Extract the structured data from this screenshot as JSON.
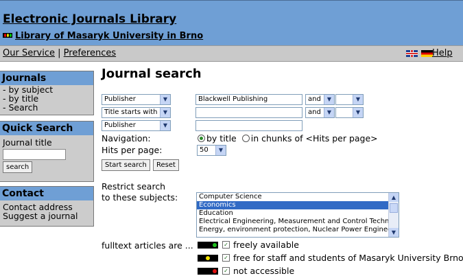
{
  "header": {
    "title": "Electronic Journals Library",
    "library": "Library of Masaryk University in Brno"
  },
  "servicebar": {
    "our_service": "Our Service",
    "separator": "|",
    "preferences": "Preferences",
    "flags": [
      "uk-flag-icon",
      "de-flag-icon"
    ],
    "help": "Help"
  },
  "sidebar": {
    "journals": {
      "title": "Journals",
      "items": [
        "- by subject",
        "- by title",
        "- Search"
      ]
    },
    "quick_search": {
      "title": "Quick Search",
      "label": "Journal title",
      "value": "",
      "button": "search"
    },
    "contact": {
      "title": "Contact",
      "items": [
        "Contact address",
        "Suggest a journal"
      ]
    }
  },
  "main": {
    "title": "Journal search",
    "rows": [
      {
        "field": "Publisher",
        "value": "Blackwell Publishing",
        "op": "and",
        "extra": ""
      },
      {
        "field": "Title starts with ...",
        "value": "",
        "op": "and",
        "extra": ""
      },
      {
        "field": "Publisher",
        "value": ""
      }
    ],
    "navigation_label": "Navigation:",
    "navigation_options": [
      "by title",
      "in chunks of <Hits per page>"
    ],
    "navigation_selected": "by title",
    "hits_label": "Hits per page:",
    "hits_value": "50",
    "start_button": "Start search",
    "reset_button": "Reset",
    "restrict_label_1": "Restrict search",
    "restrict_label_2": "to these subjects:",
    "subjects": [
      "Computer Science",
      "Economics",
      "Education",
      "Electrical Engineering, Measurement and Control Technology",
      "Energy, environment protection, Nuclear Power Engineering"
    ],
    "selected_subject": "Economics",
    "fulltext_label": "fulltext articles are ...",
    "access": [
      {
        "label": "freely available",
        "light": "green",
        "checked": true
      },
      {
        "label": "free for staff and students of Masaryk University Brno",
        "light": "yellow",
        "checked": true
      },
      {
        "label": "not accessible",
        "light": "red",
        "checked": true
      }
    ]
  },
  "colors": {
    "header_bg": "#6f9fd5",
    "bar_bg": "#c9c9c9",
    "selection": "#316ac5"
  }
}
